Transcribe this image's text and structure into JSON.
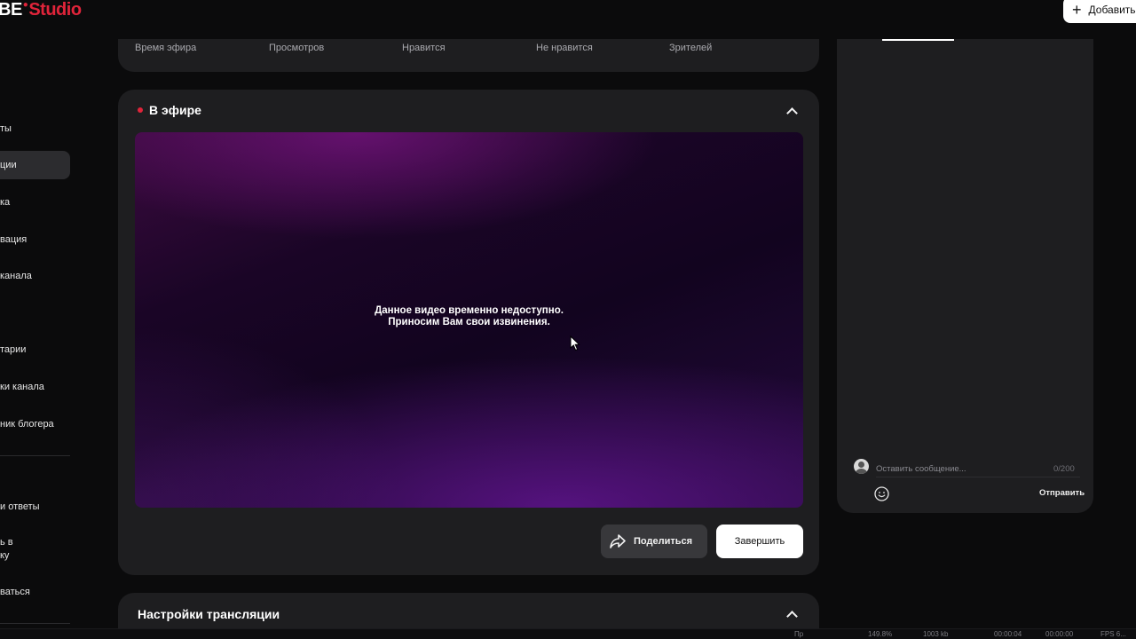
{
  "app": {
    "logo_part1": "BE",
    "logo_part2": "Studio",
    "add_button_label": "Добавить"
  },
  "sidebar": {
    "items": [
      {
        "label": "ты"
      },
      {
        "label": "ции"
      },
      {
        "label": "ка"
      },
      {
        "label": "вация"
      },
      {
        "label": "канала"
      },
      {
        "label": "тарии"
      },
      {
        "label": "ки канала"
      },
      {
        "label": "ник блогера"
      },
      {
        "label": "и ответы"
      },
      {
        "label": "ь в",
        "label2": "ку"
      },
      {
        "label": "ваться"
      }
    ],
    "active_index": 1
  },
  "stats": {
    "labels": [
      "Время эфира",
      "Просмотров",
      "Нравится",
      "Не нравится",
      "Зрителей"
    ]
  },
  "live": {
    "title": "В эфире",
    "status_color": "#e0243a",
    "player_message_line1": "Данное видео временно недоступно.",
    "player_message_line2": "Приносим Вам свои извинения.",
    "share_button": "Поделиться",
    "end_button": "Завершить"
  },
  "settings": {
    "title": "Настройки трансляции"
  },
  "chat": {
    "input_placeholder": "Оставить сообщение...",
    "counter": "0/200",
    "send_button": "Отправить"
  },
  "taskbar": {
    "items": [
      "Пр",
      "149.8%",
      "1003 kb",
      "00:00:04",
      "00:00:00",
      "FPS 6..."
    ]
  },
  "colors": {
    "accent": "#e0243a",
    "panel": "#1e1e20",
    "background": "#0b0b0c"
  }
}
